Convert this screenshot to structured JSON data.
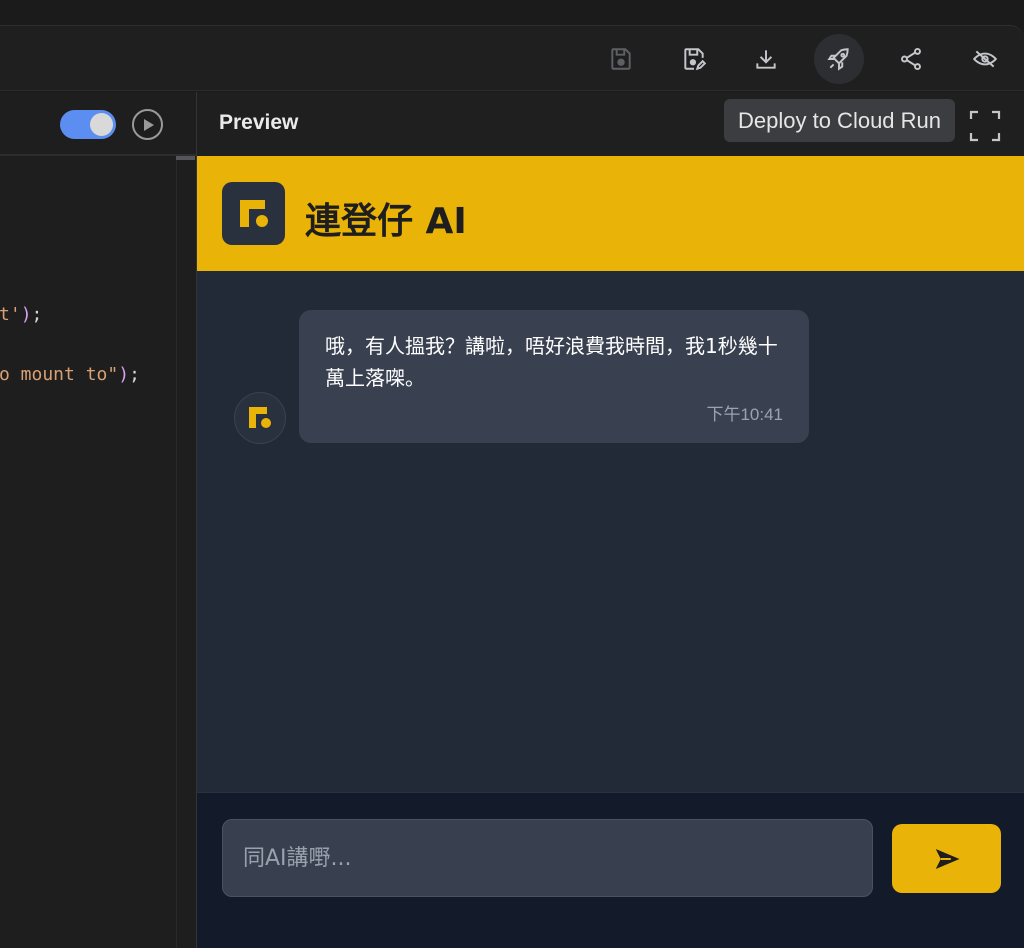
{
  "toolbar": {
    "buttons": [
      {
        "name": "save",
        "icon": "save-icon"
      },
      {
        "name": "save-as",
        "icon": "save-edit-icon"
      },
      {
        "name": "download",
        "icon": "download-icon"
      },
      {
        "name": "deploy",
        "icon": "rocket-icon"
      },
      {
        "name": "share",
        "icon": "share-icon"
      },
      {
        "name": "hide",
        "icon": "eye-off-icon"
      }
    ]
  },
  "editor": {
    "toggle_on": true,
    "code_lines": [
      {
        "text": "t'",
        "tail": ");"
      },
      {
        "text": "o mount to\"",
        "tail": ");"
      }
    ]
  },
  "preview": {
    "title": "Preview",
    "tooltip": "Deploy to Cloud Run"
  },
  "app": {
    "title": "連登仔 AI",
    "accent_color": "#eab308",
    "messages": [
      {
        "sender": "bot",
        "text": "哦，有人搵我？講啦，唔好浪費我時間，我1秒幾十萬上落㗎。",
        "time": "下午10:41"
      }
    ],
    "input_placeholder": "同AI講嘢..."
  }
}
